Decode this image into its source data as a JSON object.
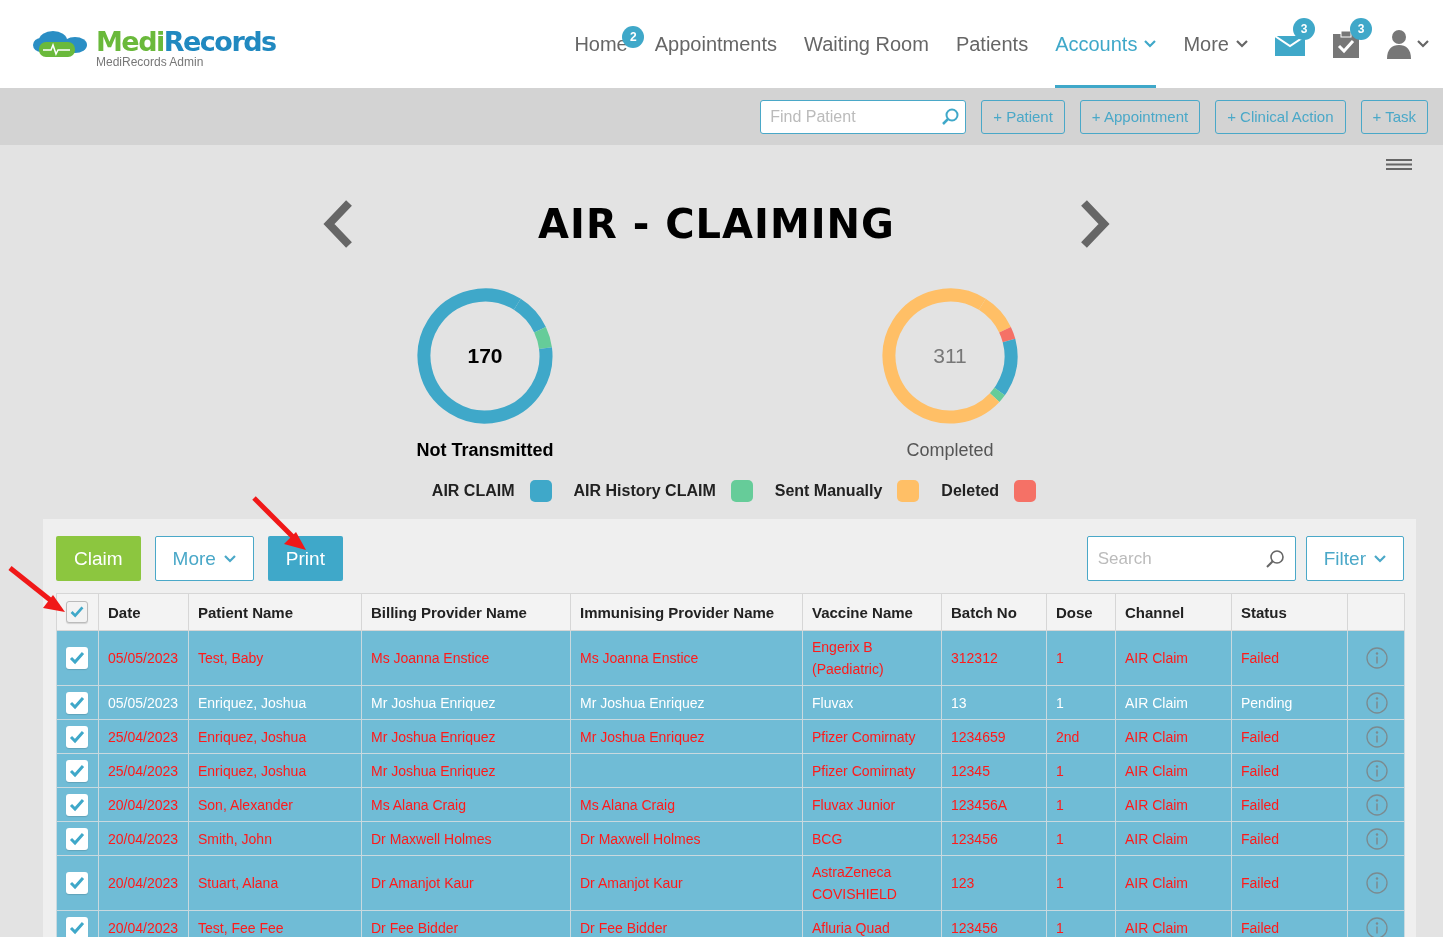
{
  "app": {
    "logo": [
      "Medi",
      "Records"
    ],
    "subtitle": "MediRecords Admin"
  },
  "nav": [
    {
      "label": "Home",
      "badge": "2",
      "selected": false,
      "dropdown": false
    },
    {
      "label": "Appointments",
      "selected": false,
      "dropdown": false
    },
    {
      "label": "Waiting Room",
      "selected": false,
      "dropdown": false
    },
    {
      "label": "Patients",
      "selected": false,
      "dropdown": false
    },
    {
      "label": "Accounts",
      "selected": true,
      "dropdown": true
    },
    {
      "label": "More",
      "selected": false,
      "dropdown": true
    }
  ],
  "nav_icons": [
    {
      "kind": "mail",
      "badge": "3"
    },
    {
      "kind": "tasks",
      "badge": "3"
    },
    {
      "kind": "user"
    }
  ],
  "toolbar": {
    "search": {
      "placeholder": "Find Patient"
    },
    "buttons": [
      "+ Patient",
      "+ Appointment",
      "+ Clinical Action",
      "+ Task"
    ]
  },
  "page_title": "AIR - CLAIMING",
  "summaries": [
    {
      "count": "170",
      "label": "Not Transmitted",
      "selected": true
    },
    {
      "count": "311",
      "label": "Completed",
      "selected": false
    }
  ],
  "legend": [
    {
      "label": "AIR CLAIM",
      "color": "#3fa8c9"
    },
    {
      "label": "AIR History CLAIM",
      "color": "#66cc99"
    },
    {
      "label": "Sent Manually",
      "color": "#ffbf66"
    },
    {
      "label": "Deleted",
      "color": "#f57166"
    }
  ],
  "actions": {
    "buttons": [
      {
        "label": "Claim",
        "kind": "primary"
      },
      {
        "label": "More",
        "kind": "dropdown"
      },
      {
        "label": "Print",
        "kind": "info"
      }
    ],
    "search": {
      "placeholder": "Search"
    },
    "filter": "Filter"
  },
  "table": {
    "all_checked": true,
    "columns": [
      "Date",
      "Patient Name",
      "Billing Provider Name",
      "Immunising Provider Name",
      "Vaccine Name",
      "Batch No",
      "Dose",
      "Channel",
      "Status"
    ],
    "rows": [
      {
        "checked": true,
        "flagged": true,
        "cells": [
          "05/05/2023",
          "Test, Baby",
          "Ms Joanna Enstice",
          "Ms Joanna Enstice",
          "Engerix B (Paediatric)",
          "312312",
          "1",
          "AIR Claim",
          "Failed"
        ]
      },
      {
        "checked": true,
        "flagged": false,
        "cells": [
          "05/05/2023",
          "Enriquez, Joshua",
          "Mr Joshua Enriquez",
          "Mr Joshua Enriquez",
          "Fluvax",
          "13",
          "1",
          "AIR Claim",
          "Pending"
        ]
      },
      {
        "checked": true,
        "flagged": true,
        "cells": [
          "25/04/2023",
          "Enriquez, Joshua",
          "Mr Joshua Enriquez",
          "Mr Joshua Enriquez",
          "Pfizer Comirnaty",
          "1234659",
          "2nd",
          "AIR Claim",
          "Failed"
        ]
      },
      {
        "checked": true,
        "flagged": true,
        "cells": [
          "25/04/2023",
          "Enriquez, Joshua",
          "Mr Joshua Enriquez",
          "",
          "Pfizer Comirnaty",
          "12345",
          "1",
          "AIR Claim",
          "Failed"
        ]
      },
      {
        "checked": true,
        "flagged": true,
        "cells": [
          "20/04/2023",
          "Son, Alexander",
          "Ms Alana Craig",
          "Ms Alana Craig",
          "Fluvax Junior",
          "123456A",
          "1",
          "AIR Claim",
          "Failed"
        ]
      },
      {
        "checked": true,
        "flagged": true,
        "cells": [
          "20/04/2023",
          "Smith, John",
          "Dr Maxwell Holmes",
          "Dr Maxwell Holmes",
          "BCG",
          "123456",
          "1",
          "AIR Claim",
          "Failed"
        ]
      },
      {
        "checked": true,
        "flagged": true,
        "cells": [
          "20/04/2023",
          "Stuart, Alana",
          "Dr Amanjot Kaur",
          "Dr Amanjot Kaur",
          "AstraZeneca COVISHIELD",
          "123",
          "1",
          "AIR Claim",
          "Failed"
        ]
      },
      {
        "checked": true,
        "flagged": true,
        "cells": [
          "20/04/2023",
          "Test, Fee Fee",
          "Dr Fee Bidder",
          "Dr Fee Bidder",
          "Afluria Quad",
          "123456",
          "1",
          "AIR Claim",
          "Failed"
        ]
      }
    ]
  }
}
